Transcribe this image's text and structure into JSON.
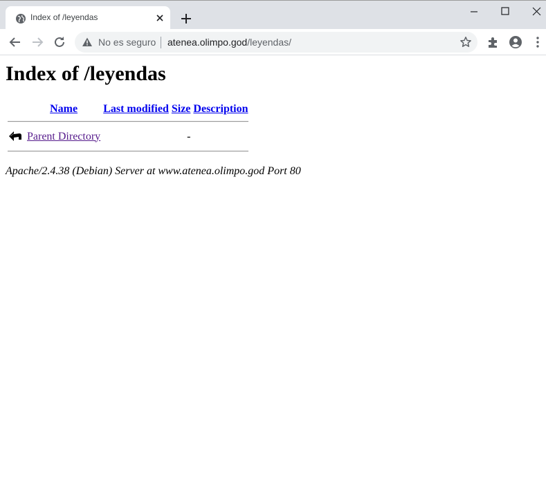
{
  "browser": {
    "tab": {
      "title": "Index of /leyendas"
    },
    "omnibox": {
      "security_label": "No es seguro",
      "url_host": "atenea.olimpo.god",
      "url_path": "/leyendas/"
    }
  },
  "page": {
    "title": "Index of /leyendas",
    "table": {
      "headers": {
        "name": "Name",
        "last_modified": "Last modified",
        "size": "Size",
        "description": "Description"
      },
      "rows": [
        {
          "name": "Parent Directory",
          "last_modified": "",
          "size": "-",
          "description": ""
        }
      ]
    },
    "footer": "Apache/2.4.38 (Debian) Server at www.atenea.olimpo.god Port 80"
  },
  "icons": {
    "favicon": "globe-icon",
    "tab_close": "close-icon",
    "new_tab": "plus-icon",
    "back": "arrow-left-icon",
    "forward": "arrow-right-icon",
    "reload": "reload-icon",
    "security": "warning-icon",
    "bookmark": "star-icon",
    "extensions": "puzzle-icon",
    "profile": "account-icon",
    "menu": "kebab-menu-icon",
    "parent_dir": "back-arrow-icon"
  },
  "colors": {
    "tabstrip_bg": "#dee1e6",
    "omnibox_bg": "#f1f3f4",
    "link": "#0000ee",
    "visited_link": "#551a8b"
  }
}
